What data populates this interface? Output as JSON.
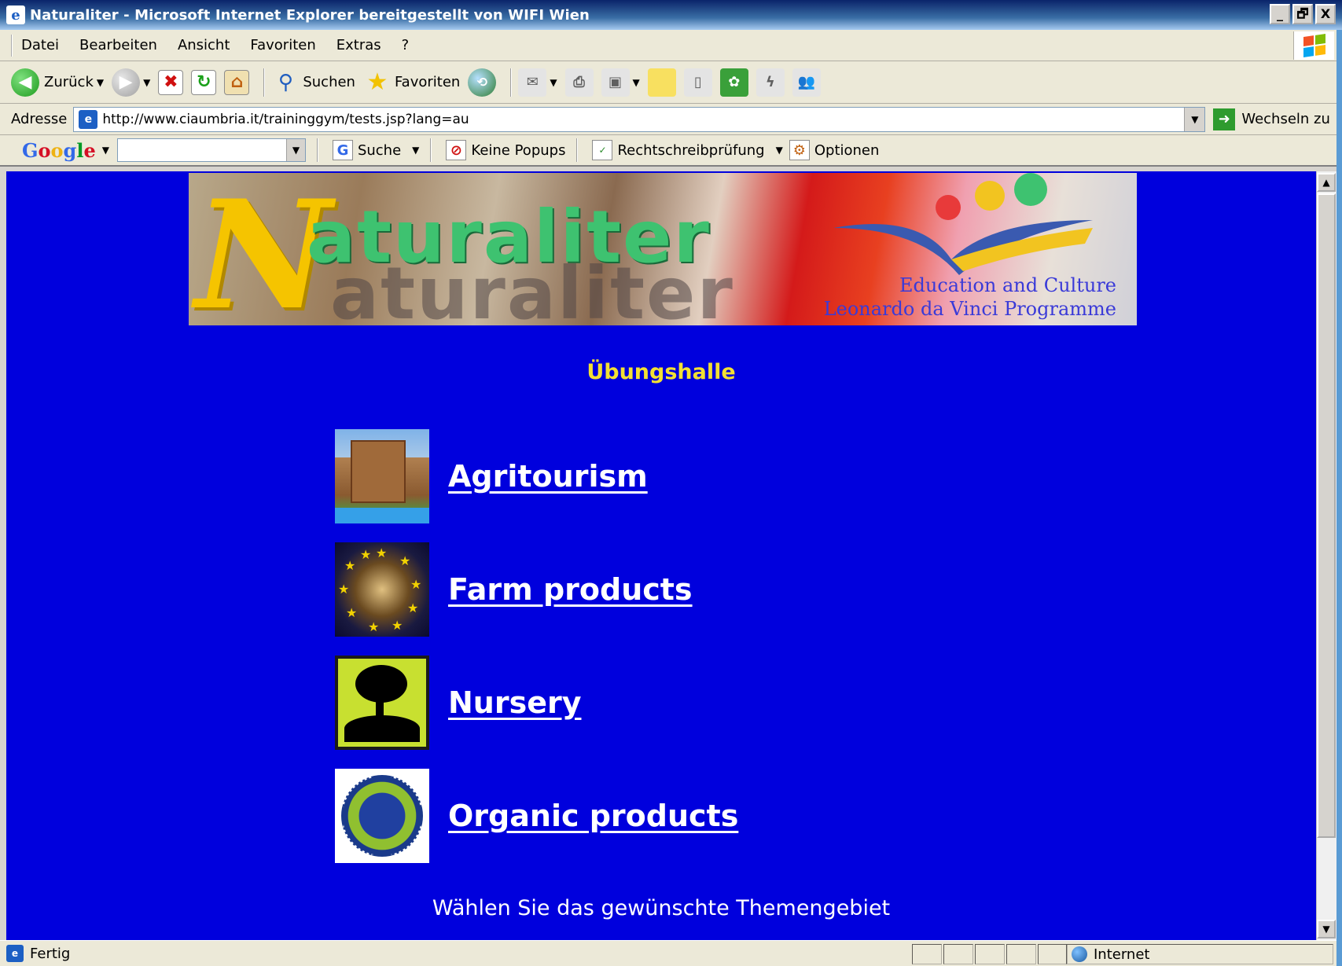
{
  "window": {
    "title": "Naturaliter - Microsoft Internet Explorer bereitgestellt von WIFI Wien",
    "controls": [
      "_",
      "🗗",
      "X"
    ]
  },
  "menu": [
    "Datei",
    "Bearbeiten",
    "Ansicht",
    "Favoriten",
    "Extras",
    "?"
  ],
  "toolbar": {
    "back_label": "Zurück",
    "search_label": "Suchen",
    "favorites_label": "Favoriten"
  },
  "address": {
    "label": "Adresse",
    "url": "http://www.ciaumbria.it/traininggym/tests.jsp?lang=au",
    "go_label": "Wechseln zu"
  },
  "google_bar": {
    "search_label": "Suche",
    "popups_label": "Keine Popups",
    "spell_label": "Rechtschreibprüfung",
    "options_label": "Optionen"
  },
  "page": {
    "banner": {
      "logo_text": "aturaliter",
      "logo_initial": "N",
      "tagline_line1": "Education and Culture",
      "tagline_line2": "Leonardo da Vinci Programme"
    },
    "heading": "Übungshalle",
    "topics": [
      {
        "label": "Agritourism"
      },
      {
        "label": "Farm products"
      },
      {
        "label": "Nursery"
      },
      {
        "label": "Organic products"
      }
    ],
    "instruction": "Wählen Sie das gewünschte Themengebiet"
  },
  "status": {
    "text": "Fertig",
    "zone": "Internet"
  },
  "colors": {
    "page_background": "#0000dd",
    "heading": "#f2e033",
    "link": "#ffffff"
  }
}
